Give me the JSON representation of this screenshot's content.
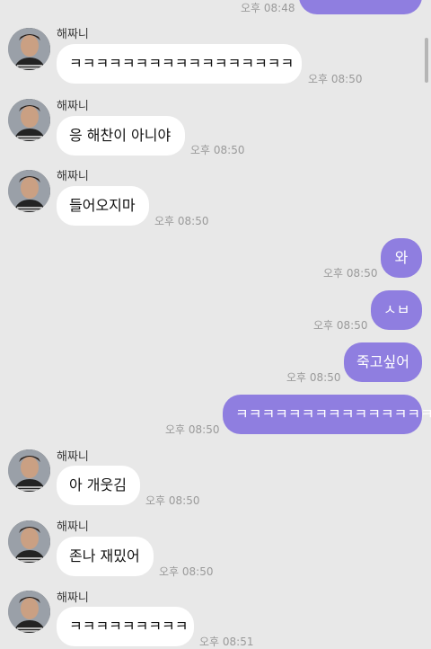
{
  "colors": {
    "background": "#e8e8e8",
    "incoming_bubble": "#ffffff",
    "outgoing_bubble": "#8f7ee0",
    "timestamp": "#9a9a9a"
  },
  "top": {
    "time": "오후 08:48"
  },
  "messages": [
    {
      "sender": "해짜니",
      "text": "ㅋㅋㅋㅋㅋㅋㅋㅋㅋㅋㅋㅋㅋㅋㅋㅋㅋ",
      "time": "오후 08:50"
    },
    {
      "sender": "해짜니",
      "text": "응 해찬이 아니야",
      "time": "오후 08:50"
    },
    {
      "sender": "해짜니",
      "text": "들어오지마",
      "time": "오후 08:50"
    },
    {
      "text": "와",
      "time": "오후 08:50"
    },
    {
      "text": "ㅅㅂ",
      "time": "오후 08:50"
    },
    {
      "text": "죽고싶어",
      "time": "오후 08:50"
    },
    {
      "text": "ㅋㅋㅋㅋㅋㅋㅋㅋㅋㅋㅋㅋㅋㅋㅋ",
      "time": "오후 08:50"
    },
    {
      "sender": "해짜니",
      "text": "아 개웃김",
      "time": "오후 08:50"
    },
    {
      "sender": "해짜니",
      "text": "존나 재밌어",
      "time": "오후 08:50"
    },
    {
      "sender": "해짜니",
      "text": "ㅋㅋㅋㅋㅋㅋㅋㅋㅋ",
      "time": "오후 08:51"
    }
  ]
}
